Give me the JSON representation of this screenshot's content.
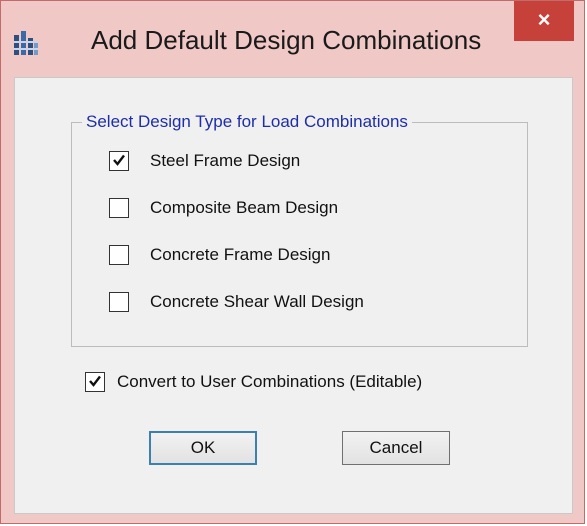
{
  "window": {
    "title": "Add Default Design Combinations",
    "close_label": "×",
    "app_icon": "etabs-app-icon"
  },
  "design_group": {
    "legend": "Select Design Type for Load Combinations",
    "items": [
      {
        "label": "Steel Frame Design",
        "checked": true
      },
      {
        "label": "Composite Beam Design",
        "checked": false
      },
      {
        "label": "Concrete Frame Design",
        "checked": false
      },
      {
        "label": "Concrete Shear Wall Design",
        "checked": false
      }
    ]
  },
  "convert_option": {
    "label": "Convert to User Combinations (Editable)",
    "checked": true
  },
  "buttons": {
    "ok_label": "OK",
    "cancel_label": "Cancel"
  },
  "colors": {
    "title_bar": "#f0c8c6",
    "close_button": "#c7413b",
    "group_legend": "#1e2ea8",
    "client_background": "#f0f0f0"
  }
}
